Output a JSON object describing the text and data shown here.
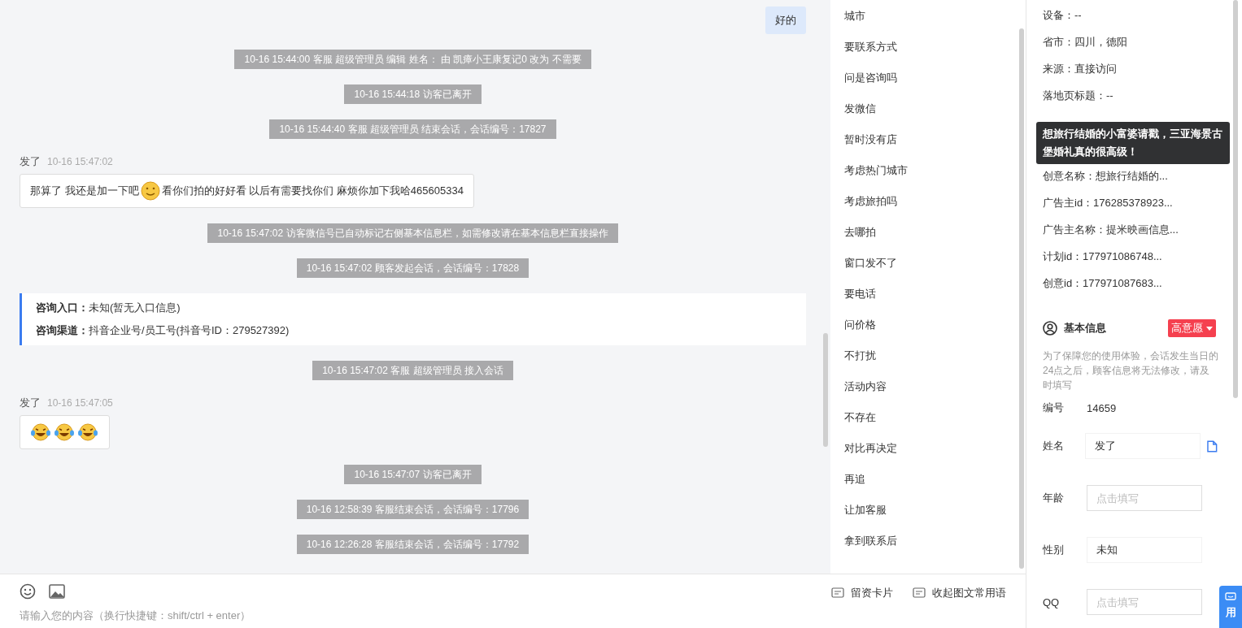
{
  "chat": {
    "messages": [
      {
        "kind": "agent",
        "text": "好的"
      },
      {
        "kind": "system",
        "text": "10-16 15:44:00 客服 超级管理员 编辑 姓名： 由 凯瘴小王康复记0 改为 不需要"
      },
      {
        "kind": "system",
        "text": "10-16 15:44:18 访客已离开"
      },
      {
        "kind": "system",
        "text": "10-16 15:44:40 客服 超级管理员 结束会话，会话编号：17827"
      },
      {
        "kind": "visitor",
        "name": "发了",
        "time": "10-16 15:47:02",
        "parts": [
          {
            "kind": "text",
            "text": "那算了 我还是加一下吧"
          },
          {
            "kind": "emoji"
          },
          {
            "kind": "text",
            "text": "看你们拍的好好看 以后有需要找你们 麻烦你加下我哈465605334"
          }
        ]
      },
      {
        "kind": "system",
        "text": "10-16 15:47:02 访客微信号已自动标记右侧基本信息栏，如需修改请在基本信息栏直接操作"
      },
      {
        "kind": "system",
        "text": "10-16 15:47:02 顾客发起会话，会话编号：17828"
      },
      {
        "kind": "info",
        "rows": [
          {
            "label": "咨询入口：",
            "value": "未知(暂无入口信息)"
          },
          {
            "label": "咨询渠道：",
            "value": "抖音企业号/员工号(抖音号ID：279527392)"
          }
        ]
      },
      {
        "kind": "system",
        "text": "10-16 15:47:02 客服 超级管理员 接入会话"
      },
      {
        "kind": "visitor",
        "name": "发了",
        "time": "10-16 15:47:05",
        "parts": [
          {
            "kind": "laugh"
          },
          {
            "kind": "laugh"
          },
          {
            "kind": "laugh"
          }
        ]
      },
      {
        "kind": "system",
        "text": "10-16 15:47:07 访客已离开"
      },
      {
        "kind": "system",
        "text": "10-16 12:58:39 客服结束会话，会话编号：17796"
      },
      {
        "kind": "system",
        "text": "10-16 12:26:28 客服结束会话，会话编号：17792"
      }
    ]
  },
  "input": {
    "placeholder": "请输入您的内容（换行快捷键：shift/ctrl + enter）"
  },
  "quick_replies": [
    "城市",
    "要联系方式",
    "问是咨询吗",
    "发微信",
    "暂时没有店",
    "考虑热门城市",
    "考虑旅拍吗",
    "去哪拍",
    "窗口发不了",
    "要电话",
    "问价格",
    "不打扰",
    "活动内容",
    "不存在",
    "对比再决定",
    "再追",
    "让加客服",
    "拿到联系后"
  ],
  "quick_actions": [
    "留资卡片",
    "收起图文常用语"
  ],
  "details": {
    "rows_top": [
      "设备：--",
      "省市：四川，德阳",
      "来源：直接访问",
      "落地页标题：--"
    ],
    "tooltip": "想旅行结婚的小富婆请戳，三亚海景古堡婚礼真的很高级！",
    "rows_bottom": [
      "创意名称：想旅行结婚的...",
      "广告主id：176285378923...",
      "广告主名称：提米映画信息...",
      "计划id：177971086748...",
      "创意id：177971087683..."
    ]
  },
  "basic_info": {
    "title": "基本信息",
    "intent": "高意愿",
    "note": "为了保障您的使用体验，会话发生当日的24点之后，顾客信息将无法修改，请及时填写",
    "fields": [
      {
        "label": "编号",
        "kind": "static",
        "value": "14659",
        "copy": false
      },
      {
        "label": "姓名",
        "kind": "filled",
        "value": "发了",
        "copy": true
      },
      {
        "label": "年龄",
        "kind": "empty",
        "placeholder": "点击填写",
        "copy": false
      },
      {
        "label": "性别",
        "kind": "filled",
        "value": "未知",
        "copy": false
      },
      {
        "label": "QQ",
        "kind": "empty",
        "placeholder": "点击填写",
        "copy": false
      }
    ]
  },
  "side_tab": {
    "label": "用"
  }
}
